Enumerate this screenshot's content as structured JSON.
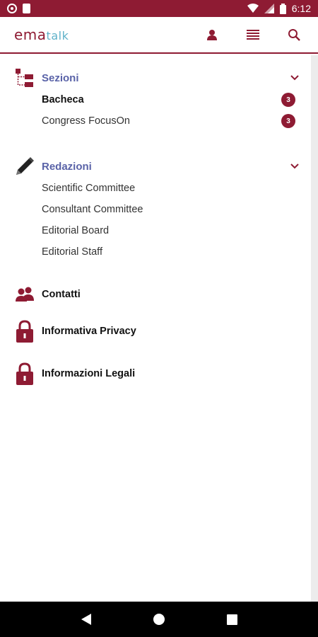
{
  "status_bar": {
    "time": "6:12"
  },
  "app": {
    "logo_part1": "ema",
    "logo_part2": "talk"
  },
  "drawer": {
    "sections": [
      {
        "title": "Sezioni",
        "items": [
          {
            "label": "Bacheca",
            "badge": "3",
            "bold": true
          },
          {
            "label": "Congress FocusOn",
            "badge": "3",
            "bold": false
          }
        ]
      },
      {
        "title": "Redazioni",
        "items": [
          {
            "label": "Scientific Committee"
          },
          {
            "label": "Consultant Committee"
          },
          {
            "label": "Editorial Board"
          },
          {
            "label": "Editorial Staff"
          }
        ]
      }
    ],
    "links": [
      {
        "label": "Contatti",
        "icon": "contacts-icon"
      },
      {
        "label": "Informativa Privacy",
        "icon": "lock-icon"
      },
      {
        "label": "Informazioni Legali",
        "icon": "lock-icon"
      }
    ]
  },
  "colors": {
    "brand": "#8e1b33",
    "section_title": "#5a63a8",
    "logo_accent": "#5fb2c9"
  }
}
